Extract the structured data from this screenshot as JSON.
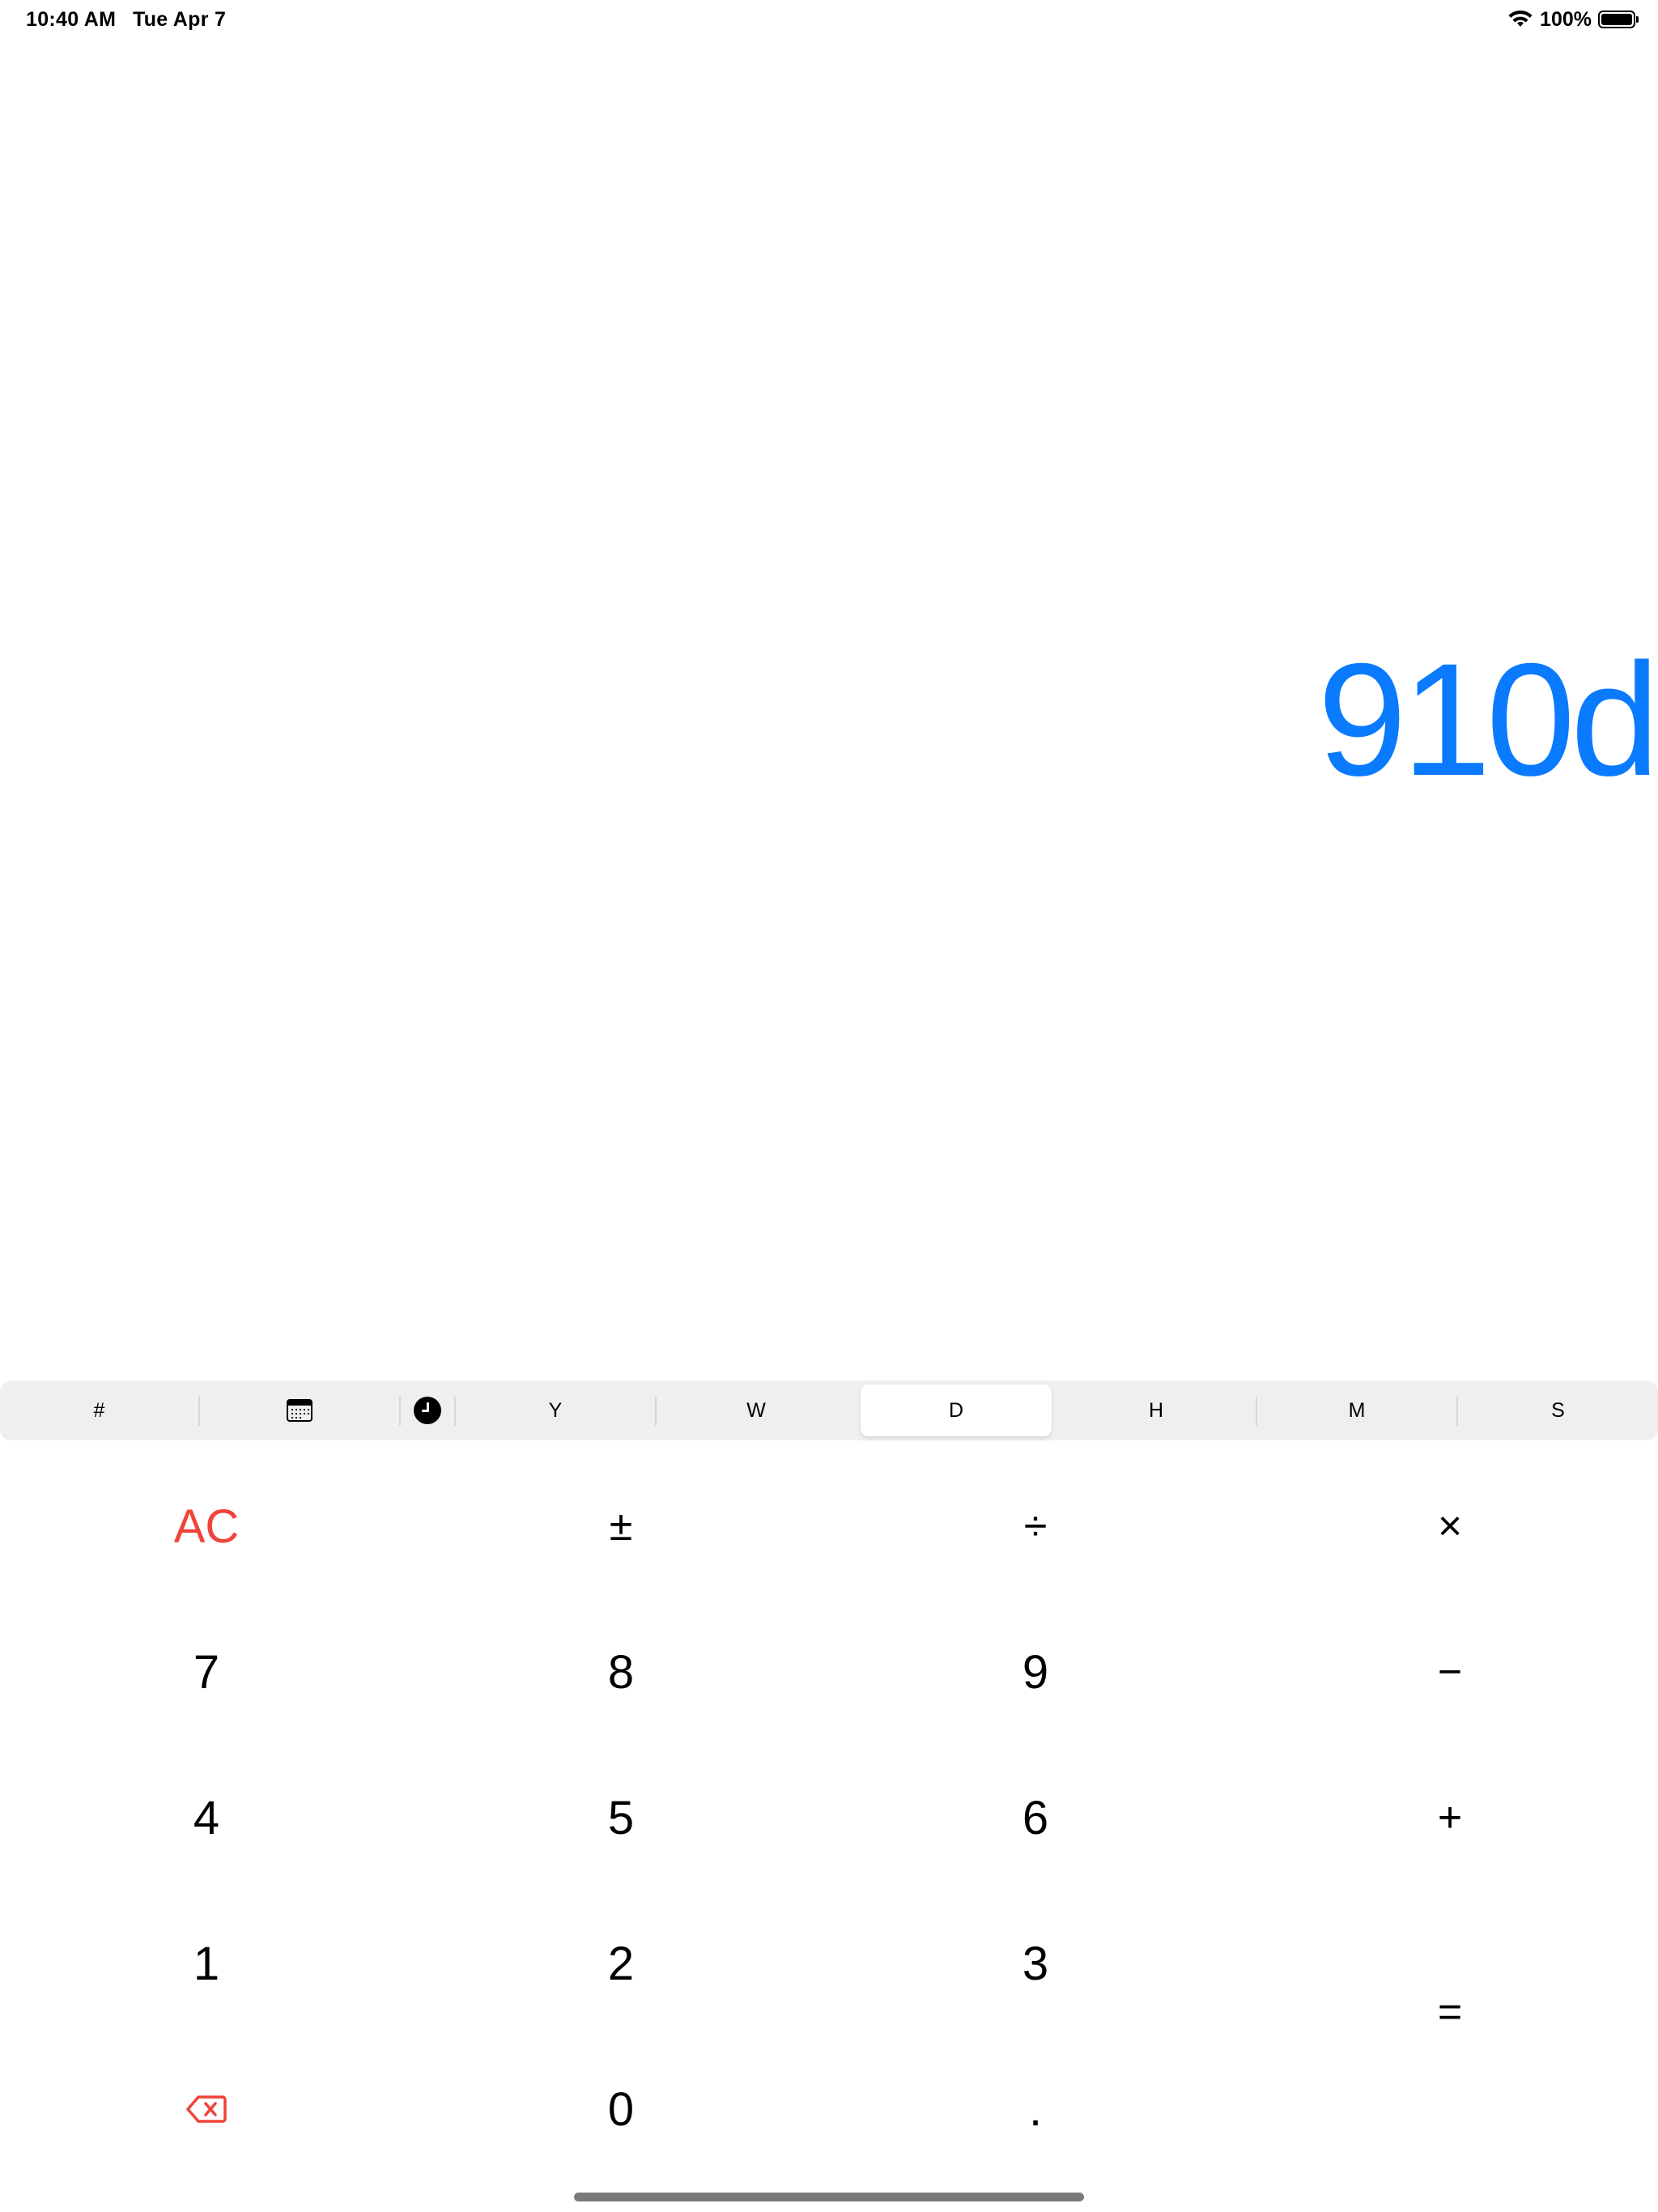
{
  "status_bar": {
    "time": "10:40 AM",
    "date": "Tue Apr 7",
    "battery_percent": "100%",
    "battery_level": 1.0
  },
  "display": {
    "value": "910d",
    "color": "#0a7aff"
  },
  "units": {
    "items": [
      {
        "label": "#",
        "icon": ""
      },
      {
        "label": "",
        "icon": "calendar-icon"
      },
      {
        "label": "",
        "icon": "clock-icon"
      },
      {
        "label": "Y",
        "icon": ""
      },
      {
        "label": "W",
        "icon": ""
      },
      {
        "label": "D",
        "icon": ""
      },
      {
        "label": "H",
        "icon": ""
      },
      {
        "label": "M",
        "icon": ""
      },
      {
        "label": "S",
        "icon": ""
      }
    ],
    "selected": "D"
  },
  "keypad": {
    "clear": "AC",
    "plus_minus": "±",
    "divide": "÷",
    "multiply": "×",
    "seven": "7",
    "eight": "8",
    "nine": "9",
    "minus": "−",
    "four": "4",
    "five": "5",
    "six": "6",
    "plus": "+",
    "one": "1",
    "two": "2",
    "three": "3",
    "equals": "=",
    "zero": "0",
    "decimal": ".",
    "backspace_icon": "backspace-icon",
    "accent_color": "#f0433a"
  }
}
